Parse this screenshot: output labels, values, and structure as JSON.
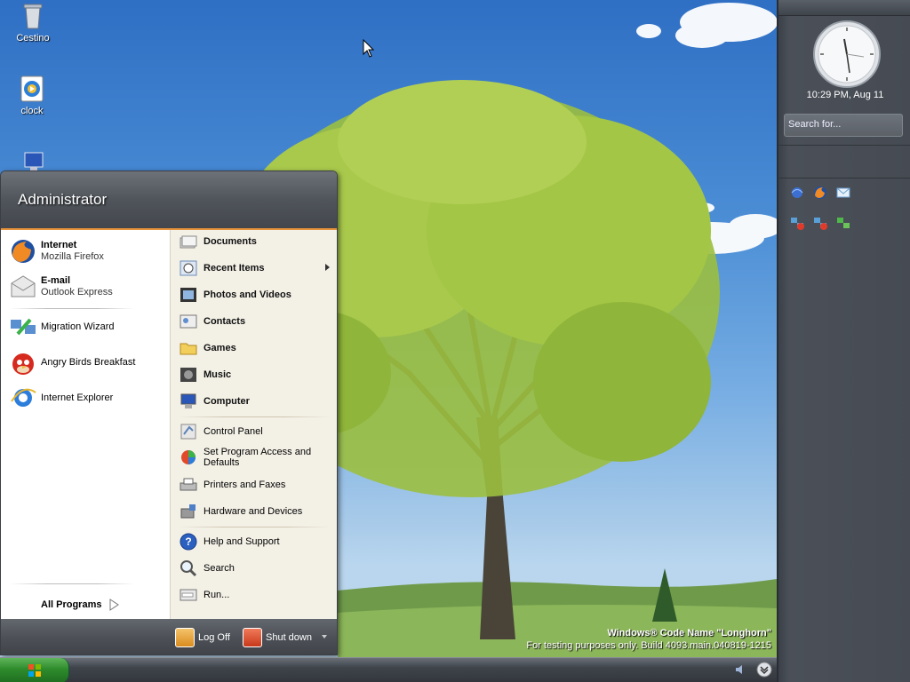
{
  "desktop": {
    "icons": [
      {
        "label": "Cestino",
        "icon": "recycle-bin-icon"
      },
      {
        "label": "clock",
        "icon": "media-player-icon"
      },
      {
        "label": "",
        "icon": "computer-icon"
      }
    ],
    "watermark": {
      "line1": "Windows® Code Name \"Longhorn\"",
      "line2": "For testing purposes only. Build 4093.main.040819-1215"
    }
  },
  "sidebar": {
    "clock_text": "10:29 PM, Aug 11",
    "search_placeholder": "Search for...",
    "tiles_row1": [
      "ie-blue-icon",
      "firefox-icon",
      "outlook-icon"
    ],
    "tiles_row2": [
      "network-disconnected-icon",
      "network-disconnected-icon",
      "network-icon"
    ]
  },
  "start_menu": {
    "user_name": "Administrator",
    "pinned": [
      {
        "title": "Internet",
        "subtitle": "Mozilla Firefox",
        "icon": "firefox-icon"
      },
      {
        "title": "E-mail",
        "subtitle": "Outlook Express",
        "icon": "email-icon"
      }
    ],
    "recent": [
      {
        "label": "Migration Wizard",
        "icon": "migration-wizard-icon"
      },
      {
        "label": "Angry Birds Breakfast",
        "icon": "angry-bird-icon"
      },
      {
        "label": "Internet Explorer",
        "icon": "internet-explorer-icon"
      }
    ],
    "all_programs": "All Programs",
    "places": [
      {
        "label": "Documents",
        "icon": "documents-icon"
      },
      {
        "label": "Recent Items",
        "icon": "recent-items-icon"
      },
      {
        "label": "Photos and Videos",
        "icon": "photos-icon"
      },
      {
        "label": "Contacts",
        "icon": "contacts-icon"
      },
      {
        "label": "Games",
        "icon": "games-icon"
      },
      {
        "label": "Music",
        "icon": "music-icon"
      },
      {
        "label": "Computer",
        "icon": "computer-icon"
      }
    ],
    "system": [
      {
        "label": "Control Panel",
        "icon": "control-panel-icon"
      },
      {
        "label": "Set Program Access and Defaults",
        "icon": "program-access-icon"
      },
      {
        "label": "Printers and Faxes",
        "icon": "printer-icon"
      },
      {
        "label": "Hardware and Devices",
        "icon": "hardware-icon"
      }
    ],
    "help": [
      {
        "label": "Help and Support",
        "icon": "help-icon"
      },
      {
        "label": "Search",
        "icon": "search-icon"
      },
      {
        "label": "Run...",
        "icon": "run-icon"
      }
    ],
    "footer": {
      "log_off": "Log Off",
      "shut_down": "Shut down"
    }
  },
  "colors": {
    "accent": "#e8923b",
    "start_button": "#2e8b2c"
  }
}
